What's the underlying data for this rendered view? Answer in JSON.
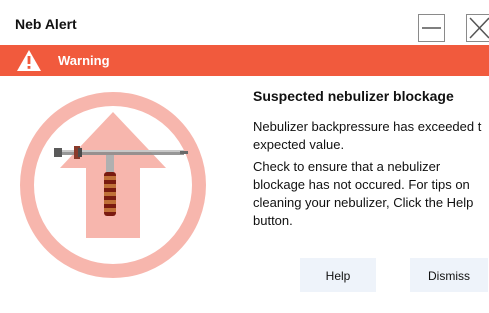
{
  "window": {
    "title": "Neb Alert",
    "minimize_icon": "minimize-icon",
    "close_icon": "close-icon"
  },
  "alert": {
    "severity_label": "Warning",
    "severity_icon": "warning-triangle-icon",
    "accent_color": "#f15a3d",
    "heading": "Suspected nebulizer blockage",
    "message_line1": "Nebulizer backpressure has exceeded t\nexpected value.",
    "message_line2": "Check to ensure that a nebulizer\nblockage has not occured. For tips on\ncleaning your nebulizer, Click the Help\nbutton.",
    "illustration_icon": "nebulizer-blocked-arrow-icon"
  },
  "buttons": {
    "help_label": "Help",
    "dismiss_label": "Dismiss"
  }
}
